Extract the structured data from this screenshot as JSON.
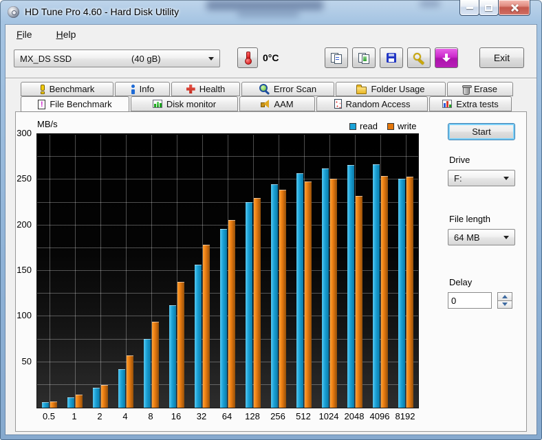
{
  "window": {
    "title": "HD Tune Pro 4.60 - Hard Disk Utility"
  },
  "menu": {
    "items": [
      "File",
      "Help"
    ]
  },
  "toolbar": {
    "drive": {
      "name": "MX_DS SSD",
      "size": "(40 gB)"
    },
    "temperature": "0°C",
    "buttons": [
      {
        "name": "copy-text",
        "icon": "copy-pages-icon"
      },
      {
        "name": "copy-image",
        "icon": "copy-image-icon"
      },
      {
        "name": "save",
        "icon": "save-icon"
      },
      {
        "name": "options",
        "icon": "wrench-icon"
      },
      {
        "name": "download",
        "icon": "download-arrow-icon",
        "color": "#C21EC2",
        "accent": true
      }
    ],
    "exit_label": "Exit"
  },
  "tabs": {
    "row1": [
      {
        "label": "Benchmark",
        "icon": "benchmark-icon"
      },
      {
        "label": "Info",
        "icon": "info-icon"
      },
      {
        "label": "Health",
        "icon": "health-icon"
      },
      {
        "label": "Error Scan",
        "icon": "error-scan-icon"
      },
      {
        "label": "Folder Usage",
        "icon": "folder-icon"
      },
      {
        "label": "Erase",
        "icon": "erase-icon"
      }
    ],
    "row2": [
      {
        "label": "File Benchmark",
        "icon": "file-benchmark-icon",
        "active": true
      },
      {
        "label": "Disk monitor",
        "icon": "disk-monitor-icon"
      },
      {
        "label": "AAM",
        "icon": "aam-icon"
      },
      {
        "label": "Random Access",
        "icon": "random-access-icon"
      },
      {
        "label": "Extra tests",
        "icon": "extra-tests-icon"
      }
    ],
    "active": "File Benchmark"
  },
  "panel": {
    "start_label": "Start",
    "drive_label": "Drive",
    "drive_value": "F:",
    "file_length_label": "File length",
    "file_length_value": "64 MB",
    "delay_label": "Delay",
    "delay_value": "0"
  },
  "chart_data": {
    "type": "bar",
    "title": "",
    "ylabel": "MB/s",
    "xlabel": "",
    "ylim": [
      0,
      300
    ],
    "grid_step": 25,
    "ytick_labels": [
      300,
      250,
      200,
      150,
      100,
      50
    ],
    "grid": true,
    "legend_position": "top-right",
    "plot_background": "#000000",
    "categories": [
      "0.5",
      "1",
      "2",
      "4",
      "8",
      "16",
      "32",
      "64",
      "128",
      "256",
      "512",
      "1024",
      "2048",
      "4096",
      "8192"
    ],
    "series": [
      {
        "name": "read",
        "color": "#1BA3D8",
        "values": [
          6,
          11,
          22,
          42,
          75,
          112,
          157,
          196,
          225,
          245,
          257,
          262,
          266,
          267,
          251
        ]
      },
      {
        "name": "write",
        "color": "#E4770B",
        "values": [
          7,
          14,
          25,
          57,
          94,
          138,
          179,
          206,
          230,
          239,
          248,
          251,
          232,
          254,
          253
        ]
      }
    ]
  }
}
